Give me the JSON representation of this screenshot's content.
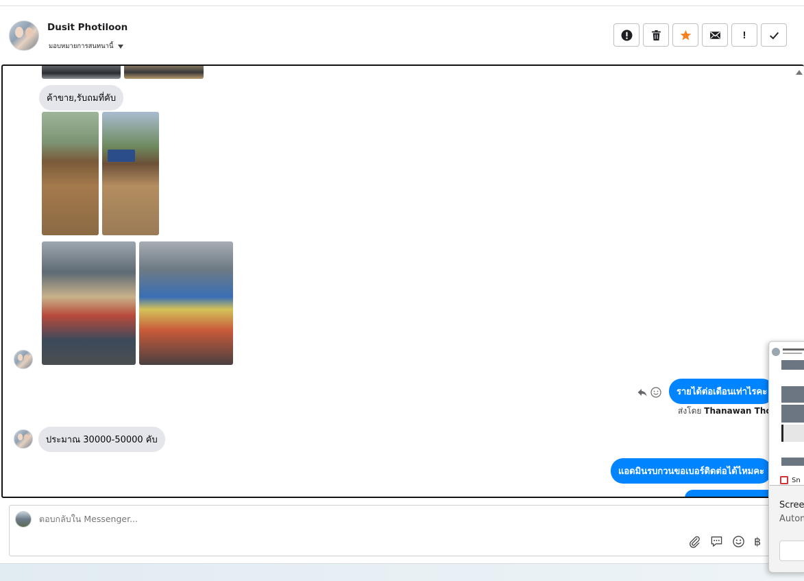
{
  "header": {
    "name": "Dusit Photiloon",
    "subtitle": "มอบหมายการสนทนานี้",
    "actions": [
      {
        "name": "spam-button",
        "icon": "alert-circle-icon"
      },
      {
        "name": "delete-button",
        "icon": "trash-icon"
      },
      {
        "name": "star-button",
        "icon": "star-icon",
        "color": "#f5821f"
      },
      {
        "name": "mark-unread-button",
        "icon": "envelope-icon"
      },
      {
        "name": "follow-up-button",
        "icon": "exclamation-icon",
        "label": "!"
      },
      {
        "name": "mark-done-button",
        "icon": "check-icon"
      }
    ]
  },
  "thread": {
    "messages": [
      {
        "direction": "incoming",
        "text": "ค้าขาย,รับถมที่คับ"
      },
      {
        "direction": "outgoing",
        "text": "รายได้ต่อเดือนเท่าไรคะ"
      },
      {
        "direction": "incoming",
        "text": "ประมาณ 30000-50000 คับ"
      },
      {
        "direction": "outgoing",
        "text": "แอดมินรบกวนขอเบอร์ติดต่อได้ไหมคะ"
      }
    ],
    "sent_by_prefix": "ส่งโดย",
    "sent_by_name": "Thanawan Thon"
  },
  "reply": {
    "placeholder": "ตอบกลับใน Messenger...",
    "currency_symbol": "฿"
  },
  "snip_popup": {
    "brand": "Sn",
    "title": "Screen",
    "description": "Autom"
  },
  "colors": {
    "accent": "#0084ff",
    "incoming_bubble": "#e4e6eb",
    "star": "#f5821f"
  }
}
